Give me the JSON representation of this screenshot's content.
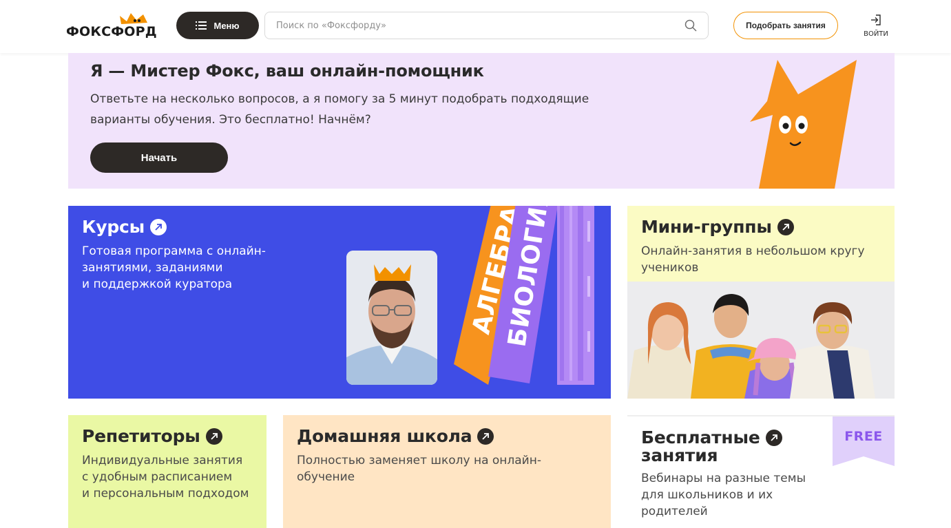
{
  "header": {
    "logo_text": "ФОКСФОРД",
    "menu_label": "Меню",
    "search_placeholder": "Поиск по «Фоксфорду»",
    "pick_label": "Подобрать занятия",
    "login_label": "ВОЙТИ"
  },
  "banner": {
    "title": "Я — Мистер Фокс, ваш онлайн-помощник",
    "text_line1": "Ответьте на несколько вопросов, а я помогу за 5 минут подобрать подходящие",
    "text_line2": "варианты обучения. Это бесплатно! Начнём?",
    "start_label": "Начать"
  },
  "cards": {
    "courses": {
      "title": "Курсы",
      "line1": "Готовая программа с онлайн-",
      "line2": "занятиями, заданиями",
      "line3": "и поддержкой куратора",
      "book1": "АЛГЕБРА",
      "book2": "БИОЛОГИЯ"
    },
    "mini": {
      "title": "Мини-группы",
      "line1": "Онлайн-занятия в небольшом кругу",
      "line2": "учеников"
    },
    "tutors": {
      "title": "Репетиторы",
      "line1": "Индивидуальные занятия",
      "line2": "с удобным расписанием",
      "line3": "и персональным подходом"
    },
    "home": {
      "title": "Домашняя школа",
      "line1": "Полностью заменяет школу на онлайн-",
      "line2": "обучение"
    },
    "free": {
      "title_line1": "Бесплатные",
      "title_line2": "занятия",
      "line1": "Вебинары на разные темы",
      "line2": "для школьников и их",
      "line3": "родителей",
      "badge": "FREE"
    }
  },
  "colors": {
    "accent_orange": "#f29100",
    "dark": "#2d2926",
    "courses_blue": "#3f4de6",
    "banner_lilac": "#f1e3fb",
    "mini_yellow": "#fbfbc4",
    "tutors_green": "#eaf8a4",
    "home_peach": "#ffe5c4",
    "free_purple": "#8b57ec"
  },
  "icons": {
    "menu": "list-icon",
    "search": "magnifier-icon",
    "login": "sign-in-icon",
    "card_arrow": "arrow-up-right-circle-icon"
  }
}
